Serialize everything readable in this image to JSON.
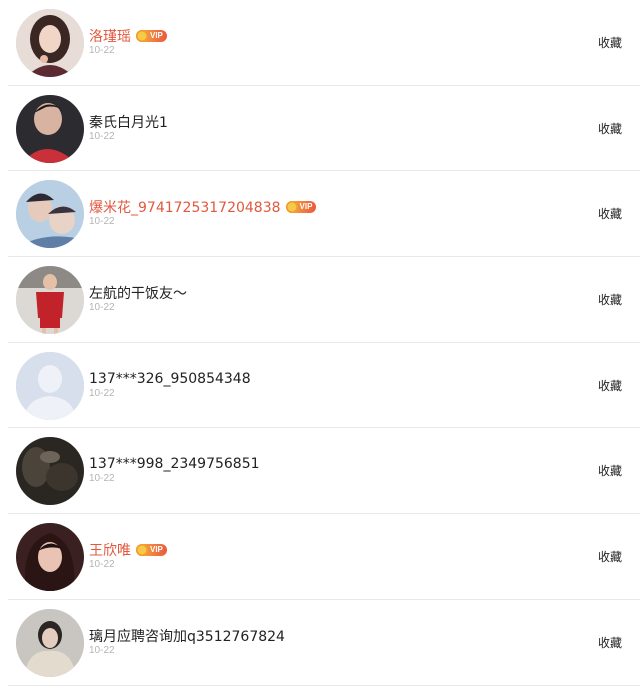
{
  "follow_list": {
    "items": [
      {
        "name": "洛瑾瑶",
        "date": "10-22",
        "action_label": "收藏",
        "vip": true,
        "vip_label": "VIP",
        "avatar": "photo-girl-dark-hair"
      },
      {
        "name": "秦氏白月光1",
        "date": "10-22",
        "action_label": "收藏",
        "vip": false,
        "avatar": "photo-boy-red-shirt"
      },
      {
        "name": "爆米花_9741725317204838",
        "date": "10-22",
        "action_label": "收藏",
        "vip": true,
        "vip_label": "VIP",
        "avatar": "photo-two-boys"
      },
      {
        "name": "左航的干饭友～",
        "date": "10-22",
        "action_label": "收藏",
        "vip": false,
        "avatar": "photo-boy-basketball-jersey"
      },
      {
        "name": "137***326_950854348",
        "date": "10-22",
        "action_label": "收藏",
        "vip": false,
        "avatar": "default-avatar-silhouette"
      },
      {
        "name": "137***998_2349756851",
        "date": "10-22",
        "action_label": "收藏",
        "vip": false,
        "avatar": "photo-dark-blurry"
      },
      {
        "name": "王欣唯",
        "date": "10-22",
        "action_label": "收藏",
        "vip": true,
        "vip_label": "VIP",
        "avatar": "photo-girl-long-hair"
      },
      {
        "name": "璃月应聘咨询加q3512767824",
        "date": "10-22",
        "action_label": "收藏",
        "vip": false,
        "avatar": "photo-girl-beige-sweater"
      }
    ]
  },
  "colors": {
    "vip_name": "#e2583e",
    "text": "#222222",
    "date": "#b4b4b4",
    "divider": "#e9e9e9"
  }
}
